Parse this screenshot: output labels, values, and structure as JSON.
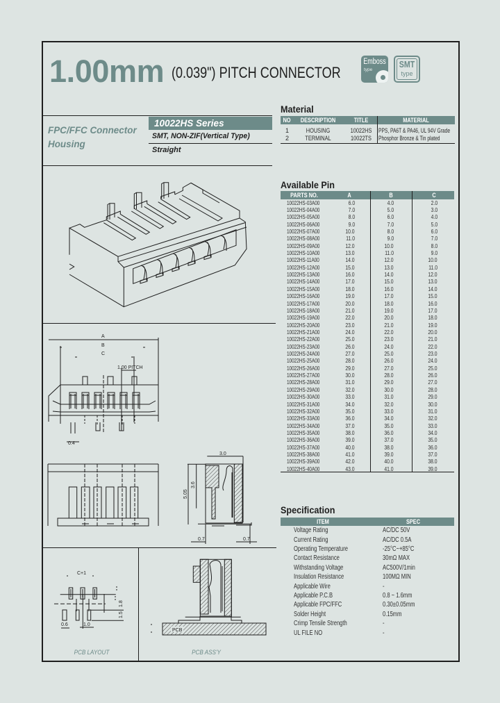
{
  "colors": {
    "accent": "#6d8b89",
    "background": "#dde4e2",
    "line": "#1e1e1e"
  },
  "header": {
    "pitch_mm": "1.00mm",
    "pitch_desc": "(0.039\") PITCH CONNECTOR",
    "badge_emboss": {
      "label": "Emboss",
      "sub": "type"
    },
    "badge_smt": {
      "label": "SMT",
      "sub": "type"
    }
  },
  "product": {
    "category_line1": "FPC/FFC Connector",
    "category_line2": "Housing",
    "series": "10022HS Series",
    "mount_type": "SMT, NON-ZIF(Vertical Type)",
    "orientation": "Straight"
  },
  "material": {
    "title": "Material",
    "columns": [
      "NO",
      "DESCRIPTION",
      "TITLE",
      "MATERIAL"
    ],
    "rows": [
      {
        "no": "1",
        "description": "HOUSING",
        "title": "10022HS",
        "material": "PPS, PA6T & PA46, UL 94V Grade"
      },
      {
        "no": "2",
        "description": "TERMINAL",
        "title": "10022TS",
        "material": "Phosphor Bronze & Tin plated"
      }
    ]
  },
  "available_pin": {
    "title": "Available Pin",
    "columns": [
      "PARTS NO.",
      "A",
      "B",
      "C"
    ],
    "rows": [
      {
        "part_no": "10022HS-03A00",
        "a": "6.0",
        "b": "4.0",
        "c": "2.0"
      },
      {
        "part_no": "10022HS-04A00",
        "a": "7.0",
        "b": "5.0",
        "c": "3.0"
      },
      {
        "part_no": "10022HS-05A00",
        "a": "8.0",
        "b": "6.0",
        "c": "4.0"
      },
      {
        "part_no": "10022HS-06A00",
        "a": "9.0",
        "b": "7.0",
        "c": "5.0"
      },
      {
        "part_no": "10022HS-07A00",
        "a": "10.0",
        "b": "8.0",
        "c": "6.0"
      },
      {
        "part_no": "10022HS-08A00",
        "a": "11.0",
        "b": "9.0",
        "c": "7.0"
      },
      {
        "part_no": "10022HS-09A00",
        "a": "12.0",
        "b": "10.0",
        "c": "8.0"
      },
      {
        "part_no": "10022HS-10A00",
        "a": "13.0",
        "b": "11.0",
        "c": "9.0"
      },
      {
        "part_no": "10022HS-11A00",
        "a": "14.0",
        "b": "12.0",
        "c": "10.0"
      },
      {
        "part_no": "10022HS-12A00",
        "a": "15.0",
        "b": "13.0",
        "c": "11.0"
      },
      {
        "part_no": "10022HS-13A00",
        "a": "16.0",
        "b": "14.0",
        "c": "12.0"
      },
      {
        "part_no": "10022HS-14A00",
        "a": "17.0",
        "b": "15.0",
        "c": "13.0"
      },
      {
        "part_no": "10022HS-15A00",
        "a": "18.0",
        "b": "16.0",
        "c": "14.0"
      },
      {
        "part_no": "10022HS-16A00",
        "a": "19.0",
        "b": "17.0",
        "c": "15.0"
      },
      {
        "part_no": "10022HS-17A00",
        "a": "20.0",
        "b": "18.0",
        "c": "16.0"
      },
      {
        "part_no": "10022HS-18A00",
        "a": "21.0",
        "b": "19.0",
        "c": "17.0"
      },
      {
        "part_no": "10022HS-19A00",
        "a": "22.0",
        "b": "20.0",
        "c": "18.0"
      },
      {
        "part_no": "10022HS-20A00",
        "a": "23.0",
        "b": "21.0",
        "c": "19.0"
      },
      {
        "part_no": "10022HS-21A00",
        "a": "24.0",
        "b": "22.0",
        "c": "20.0"
      },
      {
        "part_no": "10022HS-22A00",
        "a": "25.0",
        "b": "23.0",
        "c": "21.0"
      },
      {
        "part_no": "10022HS-23A00",
        "a": "26.0",
        "b": "24.0",
        "c": "22.0"
      },
      {
        "part_no": "10022HS-24A00",
        "a": "27.0",
        "b": "25.0",
        "c": "23.0"
      },
      {
        "part_no": "10022HS-25A00",
        "a": "28.0",
        "b": "26.0",
        "c": "24.0"
      },
      {
        "part_no": "10022HS-26A00",
        "a": "29.0",
        "b": "27.0",
        "c": "25.0"
      },
      {
        "part_no": "10022HS-27A00",
        "a": "30.0",
        "b": "28.0",
        "c": "26.0"
      },
      {
        "part_no": "10022HS-28A00",
        "a": "31.0",
        "b": "29.0",
        "c": "27.0"
      },
      {
        "part_no": "10022HS-29A00",
        "a": "32.0",
        "b": "30.0",
        "c": "28.0"
      },
      {
        "part_no": "10022HS-30A00",
        "a": "33.0",
        "b": "31.0",
        "c": "29.0"
      },
      {
        "part_no": "10022HS-31A00",
        "a": "34.0",
        "b": "32.0",
        "c": "30.0"
      },
      {
        "part_no": "10022HS-32A00",
        "a": "35.0",
        "b": "33.0",
        "c": "31.0"
      },
      {
        "part_no": "10022HS-33A00",
        "a": "36.0",
        "b": "34.0",
        "c": "32.0"
      },
      {
        "part_no": "10022HS-34A00",
        "a": "37.0",
        "b": "35.0",
        "c": "33.0"
      },
      {
        "part_no": "10022HS-35A00",
        "a": "38.0",
        "b": "36.0",
        "c": "34.0"
      },
      {
        "part_no": "10022HS-36A00",
        "a": "39.0",
        "b": "37.0",
        "c": "35.0"
      },
      {
        "part_no": "10022HS-37A00",
        "a": "40.0",
        "b": "38.0",
        "c": "36.0"
      },
      {
        "part_no": "10022HS-38A00",
        "a": "41.0",
        "b": "39.0",
        "c": "37.0"
      },
      {
        "part_no": "10022HS-39A00",
        "a": "42.0",
        "b": "40.0",
        "c": "38.0"
      },
      {
        "part_no": "10022HS-40A00",
        "a": "43.0",
        "b": "41.0",
        "c": "39.0"
      }
    ]
  },
  "specification": {
    "title": "Specification",
    "columns": [
      "ITEM",
      "SPEC"
    ],
    "rows": [
      {
        "item": "Voltage Rating",
        "spec": "AC/DC 50V"
      },
      {
        "item": "Current Rating",
        "spec": "AC/DC 0.5A"
      },
      {
        "item": "Operating Temperature",
        "spec": "-25°C~+85°C"
      },
      {
        "item": "Contact Resistance",
        "spec": "30mΩ MAX"
      },
      {
        "item": "Withstanding Voltage",
        "spec": "AC500V/1min"
      },
      {
        "item": "Insulation Resistance",
        "spec": "100MΩ MIN"
      },
      {
        "item": "Applicable Wire",
        "spec": "-"
      },
      {
        "item": "Applicable P.C.B",
        "spec": "0.8 ~ 1.6mm"
      },
      {
        "item": "Applicable FPC/FFC",
        "spec": "0.30±0.05mm"
      },
      {
        "item": "Solder Height",
        "spec": "0.15mm"
      },
      {
        "item": "Crimp Tensile Strength",
        "spec": "-"
      },
      {
        "item": "UL FILE NO",
        "spec": "-"
      }
    ]
  },
  "drawings": {
    "front_view": {
      "dim_a": "A",
      "dim_b": "B",
      "dim_c": "C",
      "pitch": "1.00 PITCH",
      "pin_width": "0.4"
    },
    "side_view": {
      "width": "3.0",
      "height_inner": "3.6",
      "height_total": "5.05",
      "foot_left": "0.7",
      "foot_right": "0.7"
    },
    "pcb_layout": {
      "title": "PCB LAYOUT",
      "dim_c": "C+1",
      "dim_1": "1.8",
      "dim_2": "1.5",
      "dim_3": "0.6",
      "dim_4": "1.0"
    },
    "pcb_assy": {
      "title": "PCB ASS'Y",
      "pcb": "PCB"
    }
  }
}
